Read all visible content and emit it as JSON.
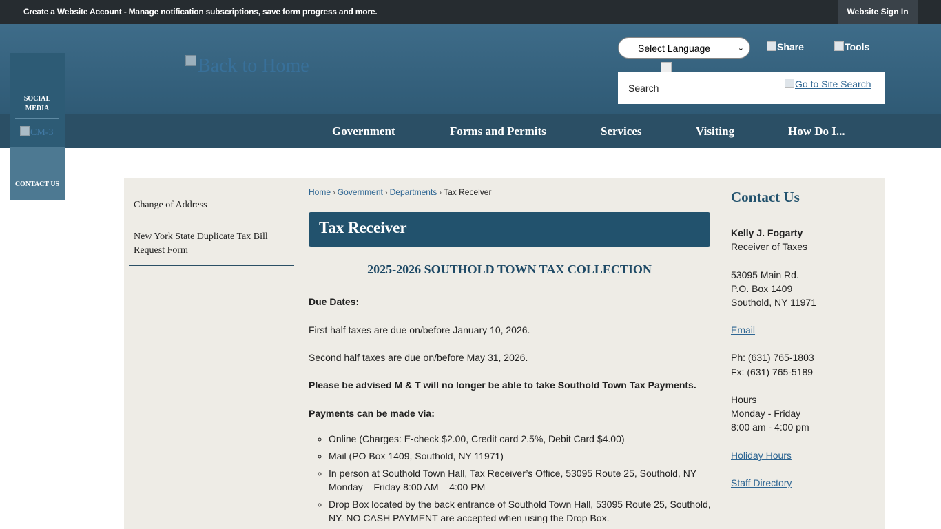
{
  "topbar": {
    "promo": "Create a Website Account - Manage notification subscriptions, save form progress and more.",
    "signin": "Website Sign In"
  },
  "header": {
    "logo_alt": "Back to Home",
    "language": "Select Language",
    "share": "Share",
    "tools": "Tools",
    "search_placeholder": "Search",
    "search_button": "Go to Site Search"
  },
  "nav": [
    "Government",
    "Forms and Permits",
    "Services",
    "Visiting",
    "How Do I..."
  ],
  "social": {
    "label_line1": "SOCIAL",
    "label_line2": "MEDIA",
    "cm_alt": "CM-3",
    "contact": "CONTACT US"
  },
  "sidenav": [
    "Change of Address",
    "New York State Duplicate Tax Bill Request Form"
  ],
  "breadcrumb": [
    "Home",
    "Government",
    "Departments",
    "Tax Receiver"
  ],
  "page_title": "Tax Receiver",
  "article": {
    "subhead": "2025-2026 SOUTHOLD TOWN TAX COLLECTION",
    "due_dates": "Due Dates:",
    "first_half": "First half taxes are due on/before January 10, 2026.",
    "second_half": "Second half taxes are due on/before May 31, 2026.",
    "advisory": "Please be advised M & T will no longer be able to take Southold Town Tax Payments.",
    "payments_via": "Payments can be made via:",
    "payment_methods": [
      "Online (Charges: E-check $2.00, Credit card 2.5%, Debit Card $4.00)",
      "Mail (PO Box 1409, Southold, NY 11971)",
      "In person at Southold Town Hall, Tax Receiver’s Office, 53095 Route 25, Southold, NY Monday – Friday 8:00 AM – 4:00 PM",
      "Drop Box located by the back entrance of Southold Town Hall, 53095 Route 25, Southold, NY.  NO CASH PAYMENT are accepted when using the Drop Box."
    ]
  },
  "contact": {
    "heading": "Contact Us",
    "name": "Kelly J. Fogarty",
    "role": "Receiver of Taxes",
    "address1": "53095 Main Rd.",
    "address2": "P.O. Box 1409",
    "address3": "Southold, NY 11971",
    "email": "Email",
    "phone": "Ph: (631) 765-1803",
    "fax": "Fx: (631) 765-5189",
    "hours_label": "Hours",
    "hours_days": "Monday - Friday",
    "hours_time": "8:00 am - 4:00 pm",
    "holiday": "Holiday Hours",
    "staff": "Staff Directory"
  }
}
